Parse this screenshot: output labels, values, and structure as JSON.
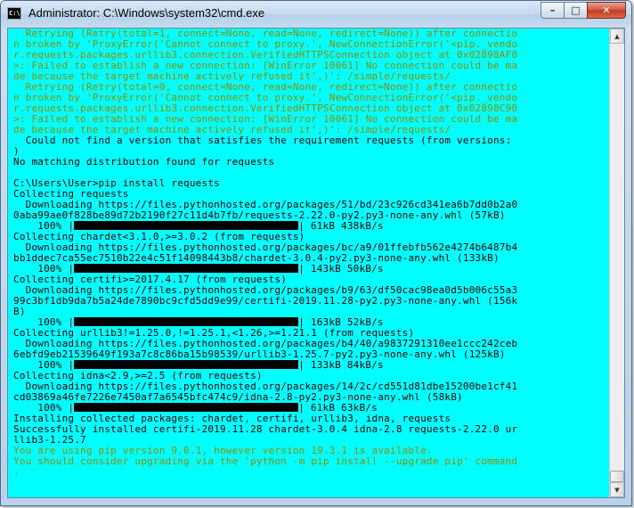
{
  "window": {
    "title": "Administrator: C:\\Windows\\system32\\cmd.exe",
    "icon": "cmd-app-icon",
    "icon_text": "C:\\",
    "buttons": {
      "minimize": "–",
      "maximize": "□",
      "close": "✕"
    }
  },
  "colors": {
    "background": "#00ffff",
    "warning_text": "#8c8c00",
    "normal_text": "#000000",
    "progress_bar": "#000000"
  },
  "scrollbar": {
    "up": "▲",
    "down": "▼"
  },
  "lines": [
    {
      "t": "y",
      "s": "  Retrying (Retry(total=1, connect=None, read=None, redirect=None)) after connectio"
    },
    {
      "t": "y",
      "s": "n broken by 'ProxyError('Cannot connect to proxy.', NewConnectionError('<pip._vendo"
    },
    {
      "t": "y",
      "s": "r.requests.packages.urllib3.connection.VerifiedHTTPSConnection object at 0x02898AF0"
    },
    {
      "t": "y",
      "s": ">: Failed to establish a new connection: [WinError 10061] No connection could be ma"
    },
    {
      "t": "y",
      "s": "de because the target machine actively refused it',)': /simple/requests/"
    },
    {
      "t": "y",
      "s": "  Retrying (Retry(total=0, connect=None, read=None, redirect=None)) after connectio"
    },
    {
      "t": "y",
      "s": "n broken by 'ProxyError('Cannot connect to proxy.', NewConnectionError('<pip._vendo"
    },
    {
      "t": "y",
      "s": "r.requests.packages.urllib3.connection.VerifiedHTTPSConnection object at 0x02898C90"
    },
    {
      "t": "y",
      "s": ">: Failed to establish a new connection: [WinError 10061] No connection could be ma"
    },
    {
      "t": "y",
      "s": "de because the target machine actively refused it',)': /simple/requests/"
    },
    {
      "t": "k",
      "s": "  Could not find a version that satisfies the requirement requests (from versions: "
    },
    {
      "t": "k",
      "s": ")"
    },
    {
      "t": "k",
      "s": "No matching distribution found for requests"
    },
    {
      "t": "k",
      "s": ""
    },
    {
      "t": "k",
      "s": "C:\\Users\\User>pip install requests"
    },
    {
      "t": "k",
      "s": "Collecting requests"
    },
    {
      "t": "k",
      "s": "  Downloading https://files.pythonhosted.org/packages/51/bd/23c926cd341ea6b7dd0b2a0"
    },
    {
      "t": "k",
      "s": "0aba99ae0f828be89d72b2190f27c11d4b7fb/requests-2.22.0-py2.py3-none-any.whl (57kB)"
    },
    {
      "t": "p",
      "pre": "    100% |",
      "post": "| 61kB 438kB/s"
    },
    {
      "t": "k",
      "s": "Collecting chardet<3.1.0,>=3.0.2 (from requests)"
    },
    {
      "t": "k",
      "s": "  Downloading https://files.pythonhosted.org/packages/bc/a9/01ffebfb562e4274b6487b4"
    },
    {
      "t": "k",
      "s": "bb1ddec7ca55ec7510b22e4c51f14098443b8/chardet-3.0.4-py2.py3-none-any.whl (133kB)"
    },
    {
      "t": "p",
      "pre": "    100% |",
      "post": "| 143kB 50kB/s"
    },
    {
      "t": "k",
      "s": "Collecting certifi>=2017.4.17 (from requests)"
    },
    {
      "t": "k",
      "s": "  Downloading https://files.pythonhosted.org/packages/b9/63/df50cac98ea0d5b006c55a3"
    },
    {
      "t": "k",
      "s": "99c3bf1db9da7b5a24de7890bc9cfd5dd9e99/certifi-2019.11.28-py2.py3-none-any.whl (156k"
    },
    {
      "t": "k",
      "s": "B)"
    },
    {
      "t": "p",
      "pre": "    100% |",
      "post": "| 163kB 52kB/s"
    },
    {
      "t": "k",
      "s": "Collecting urllib3!=1.25.0,!=1.25.1,<1.26,>=1.21.1 (from requests)"
    },
    {
      "t": "k",
      "s": "  Downloading https://files.pythonhosted.org/packages/b4/40/a9837291310ee1ccc242ceb"
    },
    {
      "t": "k",
      "s": "6ebfd9eb21539649f193a7c8c86ba15b98539/urllib3-1.25.7-py2.py3-none-any.whl (125kB)"
    },
    {
      "t": "p",
      "pre": "    100% |",
      "post": "| 133kB 84kB/s"
    },
    {
      "t": "k",
      "s": "Collecting idna<2.9,>=2.5 (from requests)"
    },
    {
      "t": "k",
      "s": "  Downloading https://files.pythonhosted.org/packages/14/2c/cd551d81dbe15200be1cf41"
    },
    {
      "t": "k",
      "s": "cd03869a46fe7226e7450af7a6545bfc474c9/idna-2.8-py2.py3-none-any.whl (58kB)"
    },
    {
      "t": "p",
      "pre": "    100% |",
      "post": "| 61kB 63kB/s"
    },
    {
      "t": "k",
      "s": "Installing collected packages: chardet, certifi, urllib3, idna, requests"
    },
    {
      "t": "k",
      "s": "Successfully installed certifi-2019.11.28 chardet-3.0.4 idna-2.8 requests-2.22.0 ur"
    },
    {
      "t": "k",
      "s": "llib3-1.25.7"
    },
    {
      "t": "y",
      "s": "You are using pip version 9.0.1, however version 19.3.1 is available."
    },
    {
      "t": "y",
      "s": "You should consider upgrading via the 'python -m pip install --upgrade pip' command"
    },
    {
      "t": "y",
      "s": "."
    }
  ]
}
